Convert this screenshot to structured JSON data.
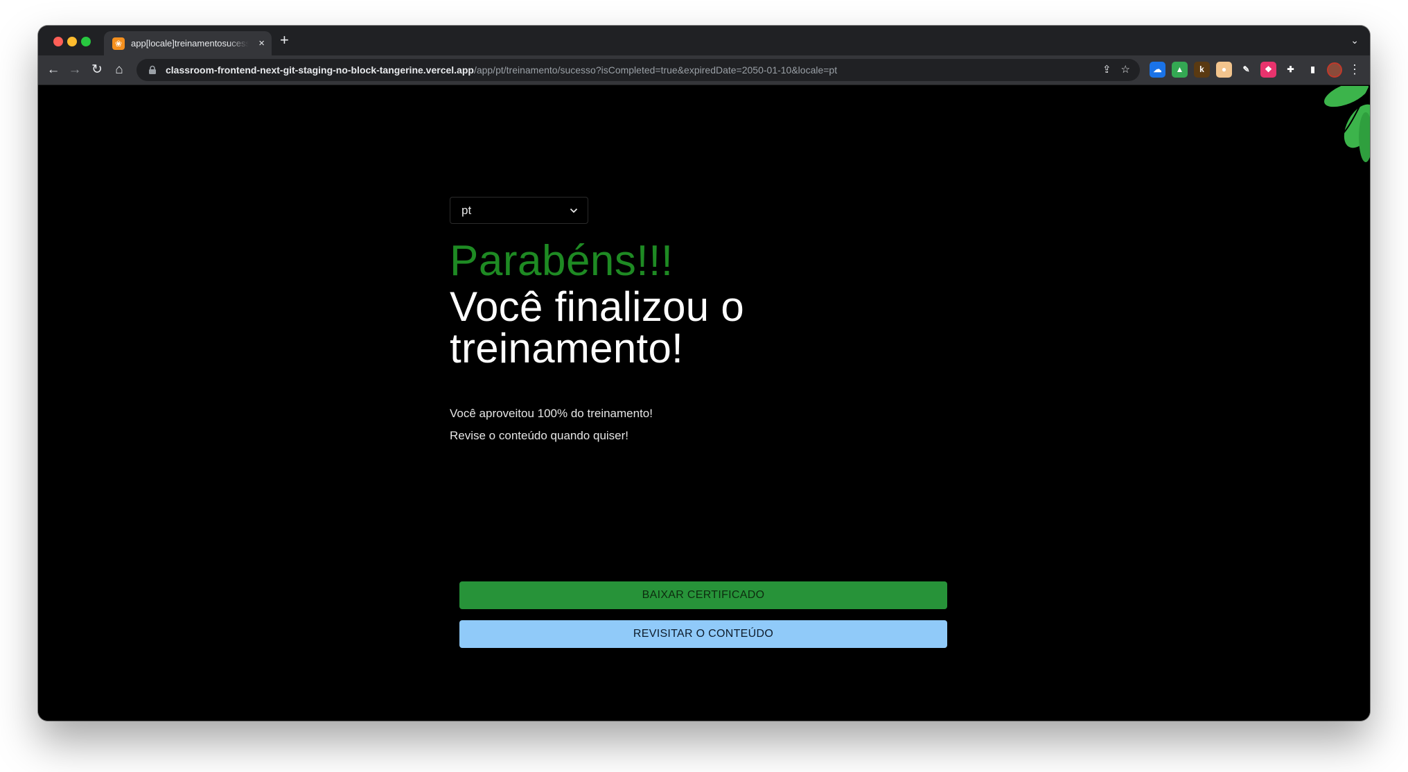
{
  "browser": {
    "tab": {
      "favicon": "tangerine-favicon",
      "title": "app[locale]treinamentosucesso",
      "close": "×"
    },
    "new_tab": "+",
    "tab_menu": "⌄",
    "address": {
      "host": "classroom-frontend-next-git-staging-no-block-tangerine.vercel.app",
      "path": "/app/pt/treinamento/sucesso?isCompleted=true&expiredDate=2050-01-10&locale=pt"
    },
    "nav": {
      "back": "←",
      "forward": "→",
      "reload": "↻",
      "home": "⌂"
    },
    "omnibox_icons": {
      "share": "⇪",
      "bookmark": "☆"
    },
    "extensions": [
      {
        "name": "cloud-extension-icon",
        "glyph": "☁",
        "color": "#1a73e8"
      },
      {
        "name": "drive-extension-icon",
        "glyph": "▲",
        "color": "#34a853"
      },
      {
        "name": "k-extension-icon",
        "glyph": "k",
        "color": "#5a3a12"
      },
      {
        "name": "egg-extension-icon",
        "glyph": "●",
        "color": "#f2c48d"
      },
      {
        "name": "eyedropper-extension-icon",
        "glyph": "✎",
        "color": "#35363a"
      },
      {
        "name": "pink-extension-icon",
        "glyph": "❖",
        "color": "#e8336d"
      },
      {
        "name": "puzzle-extension-icon",
        "glyph": "✚",
        "color": "#35363a"
      },
      {
        "name": "sidepanel-extension-icon",
        "glyph": "▮",
        "color": "#35363a"
      }
    ],
    "menu": "⋮"
  },
  "page": {
    "language_select": {
      "value": "pt"
    },
    "title_highlight": "Parabéns!!!",
    "title_main": "Você finalizou o treinamento!",
    "lines": [
      "Você aproveitou 100% do treinamento!",
      "Revise o conteúdo quando quiser!"
    ],
    "buttons": {
      "download": "BAIXAR CERTIFICADO",
      "revisit": "REVISITAR O CONTEÚDO"
    }
  },
  "colors": {
    "highlight_green": "#1e8a23",
    "download_button": "#279339",
    "revisit_button": "#90caf9",
    "leaf": "#3cb44b"
  }
}
